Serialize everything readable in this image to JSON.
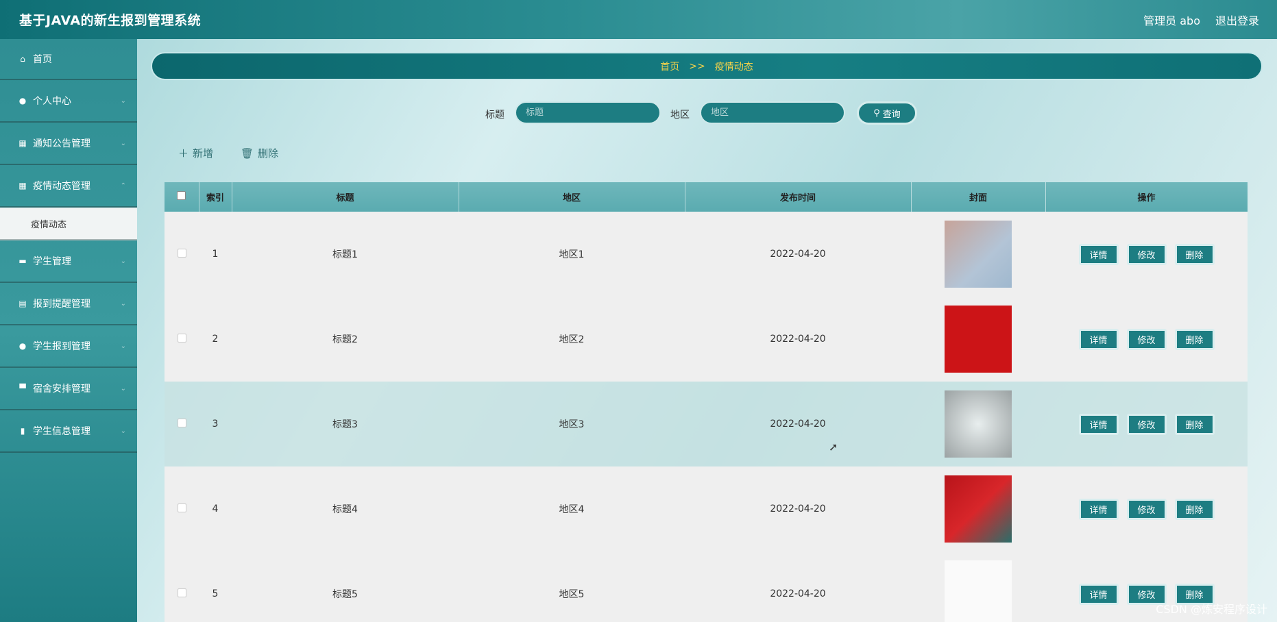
{
  "header": {
    "title": "基于JAVA的新生报到管理系统",
    "user": "管理员 abo",
    "logout": "退出登录"
  },
  "sidebar": {
    "items": [
      {
        "label": "首页",
        "icon": "home-icon"
      },
      {
        "label": "个人中心",
        "icon": "user-icon"
      },
      {
        "label": "通知公告管理",
        "icon": "grid-icon"
      },
      {
        "label": "疫情动态管理",
        "icon": "grid-icon"
      },
      {
        "label": "学生管理",
        "icon": "monitor-icon"
      },
      {
        "label": "报到提醒管理",
        "icon": "clipboard-icon"
      },
      {
        "label": "学生报到管理",
        "icon": "user-icon"
      },
      {
        "label": "宿舍安排管理",
        "icon": "bed-icon"
      },
      {
        "label": "学生信息管理",
        "icon": "bar-chart-icon"
      }
    ],
    "active_sub": "疫情动态"
  },
  "breadcrumb": {
    "home": "首页",
    "sep": ">>",
    "current": "疫情动态"
  },
  "search": {
    "title_label": "标题",
    "title_placeholder": "标题",
    "region_label": "地区",
    "region_placeholder": "地区",
    "query_label": "查询"
  },
  "actions": {
    "add": "新增",
    "delete": "删除"
  },
  "table": {
    "columns": [
      "索引",
      "标题",
      "地区",
      "发布时间",
      "封面",
      "操作"
    ],
    "rows": [
      {
        "index": "1",
        "title": "标题1",
        "region": "地区1",
        "date": "2022-04-20"
      },
      {
        "index": "2",
        "title": "标题2",
        "region": "地区2",
        "date": "2022-04-20"
      },
      {
        "index": "3",
        "title": "标题3",
        "region": "地区3",
        "date": "2022-04-20"
      },
      {
        "index": "4",
        "title": "标题4",
        "region": "地区4",
        "date": "2022-04-20"
      },
      {
        "index": "5",
        "title": "标题5",
        "region": "地区5",
        "date": "2022-04-20"
      }
    ],
    "ops": {
      "detail": "详情",
      "edit": "修改",
      "delete": "删除"
    }
  },
  "watermark": "CSDN @炼安程序设计",
  "colors": {
    "brand": "#1d7d82",
    "breadcrumb_text": "#f5d34a"
  }
}
